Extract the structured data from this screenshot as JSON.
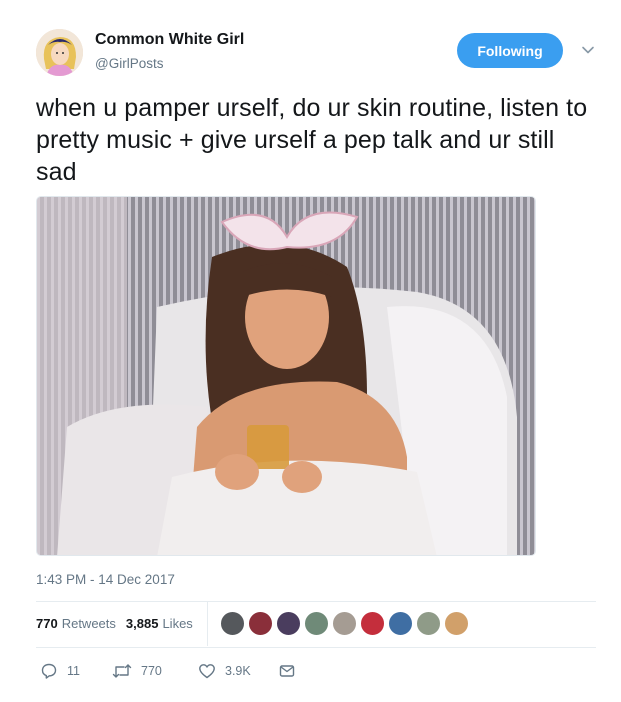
{
  "author": {
    "display_name": "Common White Girl",
    "handle": "@GirlPosts",
    "avatar_icon": "cartoon-princess-avatar"
  },
  "follow_button": {
    "label": "Following",
    "color": "#3a9ef0"
  },
  "tweet": {
    "text": "when u pamper urself, do ur skin routine, listen to pretty music + give urself a pep talk and ur still sad",
    "timestamp": "1:43 PM - 14 Dec 2017"
  },
  "media": {
    "icon": "photo-woman-in-bed-with-tea"
  },
  "stats": {
    "retweets_count": "770",
    "retweets_label": "Retweets",
    "likes_count": "3,885",
    "likes_label": "Likes"
  },
  "likers": [
    {
      "icon": "liker-avatar",
      "color": "#55585c"
    },
    {
      "icon": "liker-avatar",
      "color": "#8a2f3a"
    },
    {
      "icon": "liker-avatar",
      "color": "#4a3d5e"
    },
    {
      "icon": "liker-avatar",
      "color": "#6f8a78"
    },
    {
      "icon": "liker-avatar",
      "color": "#a59c93"
    },
    {
      "icon": "liker-avatar",
      "color": "#c42e3c"
    },
    {
      "icon": "liker-avatar",
      "color": "#3f6ea3"
    },
    {
      "icon": "liker-avatar",
      "color": "#8f9b88"
    },
    {
      "icon": "liker-avatar",
      "color": "#d1a06a"
    }
  ],
  "actions": {
    "reply_count": "11",
    "retweet_count": "770",
    "like_count": "3.9K"
  }
}
